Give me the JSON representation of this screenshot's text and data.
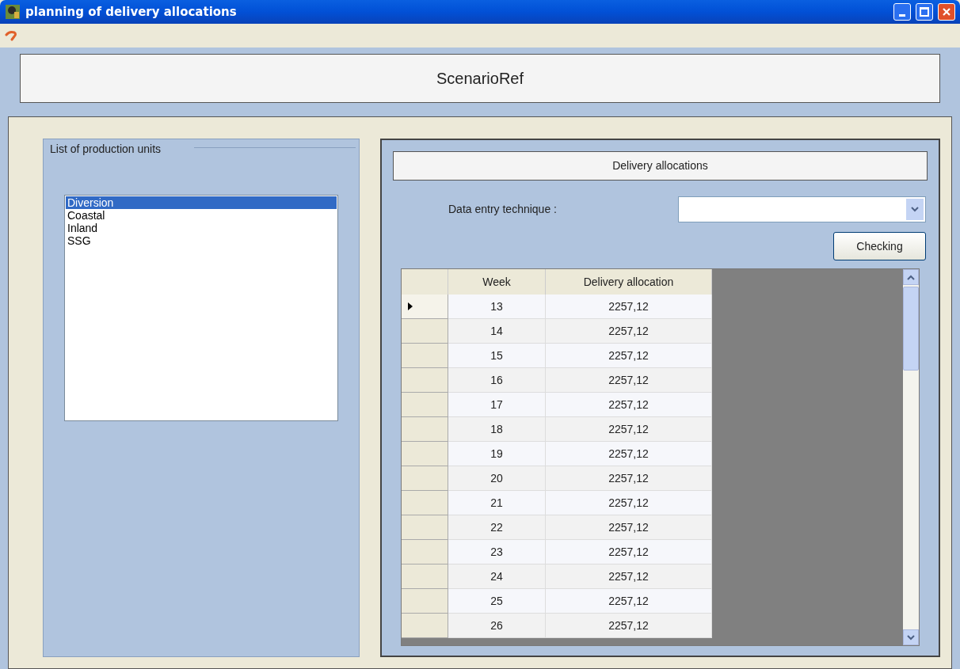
{
  "window": {
    "title": "planning of delivery allocations"
  },
  "scenario": {
    "title": "ScenarioRef"
  },
  "units": {
    "legend": "List of production units",
    "items": [
      {
        "label": "Diversion",
        "selected": true
      },
      {
        "label": "Coastal",
        "selected": false
      },
      {
        "label": "Inland",
        "selected": false
      },
      {
        "label": "SSG",
        "selected": false
      }
    ]
  },
  "allocations": {
    "title": "Delivery allocations",
    "technique_label": "Data entry technique :",
    "checking_button": "Checking",
    "table": {
      "columns": [
        "Week",
        "Delivery allocation"
      ],
      "rows": [
        {
          "week": "13",
          "allocation": "2257,12",
          "selected": true
        },
        {
          "week": "14",
          "allocation": "2257,12",
          "selected": false
        },
        {
          "week": "15",
          "allocation": "2257,12",
          "selected": false
        },
        {
          "week": "16",
          "allocation": "2257,12",
          "selected": false
        },
        {
          "week": "17",
          "allocation": "2257,12",
          "selected": false
        },
        {
          "week": "18",
          "allocation": "2257,12",
          "selected": false
        },
        {
          "week": "19",
          "allocation": "2257,12",
          "selected": false
        },
        {
          "week": "20",
          "allocation": "2257,12",
          "selected": false
        },
        {
          "week": "21",
          "allocation": "2257,12",
          "selected": false
        },
        {
          "week": "22",
          "allocation": "2257,12",
          "selected": false
        },
        {
          "week": "23",
          "allocation": "2257,12",
          "selected": false
        },
        {
          "week": "24",
          "allocation": "2257,12",
          "selected": false
        },
        {
          "week": "25",
          "allocation": "2257,12",
          "selected": false
        },
        {
          "week": "26",
          "allocation": "2257,12",
          "selected": false
        }
      ]
    }
  }
}
